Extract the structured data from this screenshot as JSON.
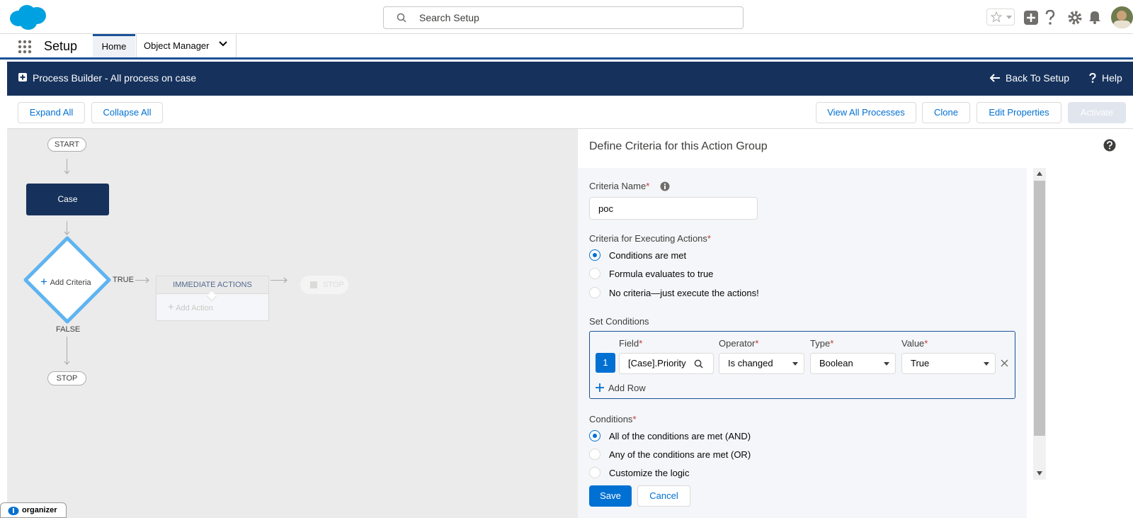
{
  "search": {
    "placeholder": "Search Setup"
  },
  "nav": {
    "app_name": "Setup",
    "tabs": [
      {
        "label": "Home"
      },
      {
        "label": "Object Manager"
      }
    ]
  },
  "header": {
    "title": "Process Builder - All process on case",
    "back_label": "Back To Setup",
    "help_label": "Help"
  },
  "toolbar": {
    "expand_all": "Expand All",
    "collapse_all": "Collapse All",
    "view_all": "View All Processes",
    "clone": "Clone",
    "edit_properties": "Edit Properties",
    "activate": "Activate"
  },
  "canvas": {
    "start": "START",
    "object": "Case",
    "criteria": "Add Criteria",
    "true_label": "TRUE",
    "false_label": "FALSE",
    "immediate_actions": "IMMEDIATE ACTIONS",
    "add_action": "Add Action",
    "stop_inline": "STOP",
    "stop": "STOP"
  },
  "panel": {
    "title": "Define Criteria for this Action Group",
    "criteria_name_label": "Criteria Name",
    "criteria_name_value": "poc",
    "executing_label": "Criteria for Executing Actions",
    "executing_options": [
      {
        "label": "Conditions are met",
        "selected": true
      },
      {
        "label": "Formula evaluates to true",
        "selected": false
      },
      {
        "label": "No criteria—just execute the actions!",
        "selected": false
      }
    ],
    "set_conditions_label": "Set Conditions",
    "columns": {
      "field": "Field",
      "operator": "Operator",
      "type": "Type",
      "value": "Value"
    },
    "row": {
      "number": "1",
      "field": "[Case].Priority",
      "operator": "Is changed",
      "type": "Boolean",
      "value": "True"
    },
    "add_row": "Add Row",
    "conditions_label": "Conditions",
    "condition_options": [
      {
        "label": "All of the conditions are met (AND)",
        "selected": true
      },
      {
        "label": "Any of the conditions are met (OR)",
        "selected": false
      },
      {
        "label": "Customize the logic",
        "selected": false
      }
    ],
    "save": "Save",
    "cancel": "Cancel"
  },
  "organizer": {
    "label": "organizer"
  },
  "colors": {
    "brand_navy": "#16325c",
    "accent_blue": "#0070d2",
    "diamond_blue": "#5eb4f0"
  }
}
